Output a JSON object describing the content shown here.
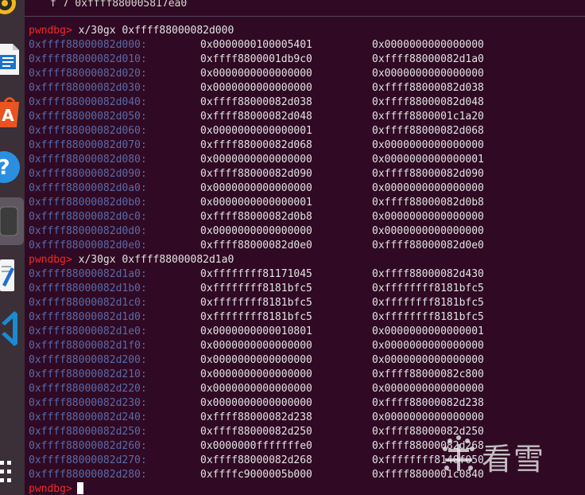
{
  "terminal": {
    "top_line": "f 7 0xffff880005817ea0",
    "prompt": "pwndbg>",
    "commands": [
      "x/30gx 0xffff88000082d000",
      "x/30gx 0xffff88000082d1a0"
    ],
    "block1": [
      [
        "0xffff88000082d000:",
        "0x0000000100005401",
        "0x0000000000000000"
      ],
      [
        "0xffff88000082d010:",
        "0xffff8800001db9c0",
        "0xffff88000082d1a0"
      ],
      [
        "0xffff88000082d020:",
        "0x0000000000000000",
        "0x0000000000000000"
      ],
      [
        "0xffff88000082d030:",
        "0x0000000000000000",
        "0xffff88000082d038"
      ],
      [
        "0xffff88000082d040:",
        "0xffff88000082d038",
        "0xffff88000082d048"
      ],
      [
        "0xffff88000082d050:",
        "0xffff88000082d048",
        "0xffff8800001c1a20"
      ],
      [
        "0xffff88000082d060:",
        "0x0000000000000001",
        "0xffff88000082d068"
      ],
      [
        "0xffff88000082d070:",
        "0xffff88000082d068",
        "0x0000000000000000"
      ],
      [
        "0xffff88000082d080:",
        "0x0000000000000000",
        "0x0000000000000001"
      ],
      [
        "0xffff88000082d090:",
        "0xffff88000082d090",
        "0xffff88000082d090"
      ],
      [
        "0xffff88000082d0a0:",
        "0x0000000000000000",
        "0x0000000000000000"
      ],
      [
        "0xffff88000082d0b0:",
        "0x0000000000000001",
        "0xffff88000082d0b8"
      ],
      [
        "0xffff88000082d0c0:",
        "0xffff88000082d0b8",
        "0x0000000000000000"
      ],
      [
        "0xffff88000082d0d0:",
        "0x0000000000000000",
        "0x0000000000000000"
      ],
      [
        "0xffff88000082d0e0:",
        "0xffff88000082d0e0",
        "0xffff88000082d0e0"
      ]
    ],
    "block2": [
      [
        "0xffff88000082d1a0:",
        "0xffffffff81171045",
        "0xffff88000082d430"
      ],
      [
        "0xffff88000082d1b0:",
        "0xffffffff8181bfc5",
        "0xffffffff8181bfc5"
      ],
      [
        "0xffff88000082d1c0:",
        "0xffffffff8181bfc5",
        "0xffffffff8181bfc5"
      ],
      [
        "0xffff88000082d1d0:",
        "0xffffffff8181bfc5",
        "0xffffffff8181bfc5"
      ],
      [
        "0xffff88000082d1e0:",
        "0x0000000000010801",
        "0x0000000000000001"
      ],
      [
        "0xffff88000082d1f0:",
        "0x0000000000000000",
        "0x0000000000000000"
      ],
      [
        "0xffff88000082d200:",
        "0x0000000000000000",
        "0x0000000000000000"
      ],
      [
        "0xffff88000082d210:",
        "0x0000000000000000",
        "0xffff88000082c800"
      ],
      [
        "0xffff88000082d220:",
        "0x0000000000000000",
        "0x0000000000000000"
      ],
      [
        "0xffff88000082d230:",
        "0x0000000000000000",
        "0xffff88000082d238"
      ],
      [
        "0xffff88000082d240:",
        "0xffff88000082d238",
        "0x0000000000000000"
      ],
      [
        "0xffff88000082d250:",
        "0xffff88000082d250",
        "0xffff88000082d250"
      ],
      [
        "0xffff88000082d260:",
        "0x0000000fffffffe0",
        "0xffff88000082d268"
      ],
      [
        "0xffff88000082d270:",
        "0xffff88000082d268",
        "0xffffffff8140f050"
      ],
      [
        "0xffff88000082d280:",
        "0xffffc9000005b000",
        "0xffff8800001c0840"
      ]
    ]
  },
  "watermark": {
    "text": "看雪"
  },
  "colors": {
    "background": "#300a24",
    "prompt": "#ef2929",
    "address": "#5a6aa8",
    "value": "#e3e3e3"
  }
}
